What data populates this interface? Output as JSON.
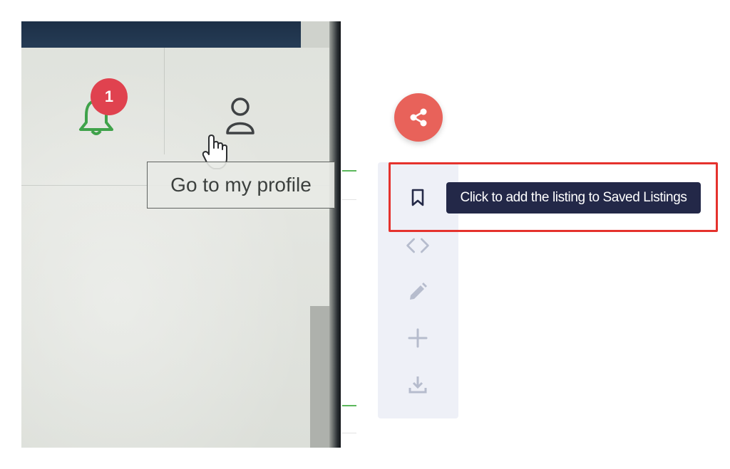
{
  "photo": {
    "notification_count": "1",
    "profile_tooltip": "Go to my profile"
  },
  "toolbar": {
    "items": [
      {
        "icon": "bookmark-icon"
      },
      {
        "icon": "code-icon"
      },
      {
        "icon": "pencil-icon"
      },
      {
        "icon": "plus-icon"
      },
      {
        "icon": "download-icon"
      }
    ],
    "save_tooltip": "Click to add the listing to Saved Listings"
  },
  "colors": {
    "share_button": "#e8625a",
    "toolbar_bg": "#eef0f7",
    "tooltip_bg": "#232848",
    "highlight": "#e5322d",
    "bell": "#3fa24a",
    "badge": "#e0424f"
  }
}
